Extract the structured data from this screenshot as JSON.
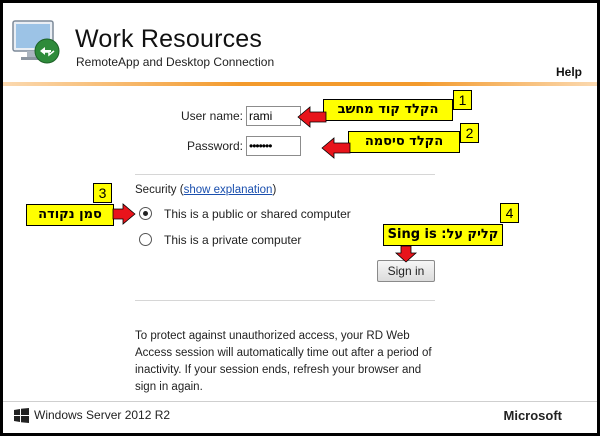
{
  "header": {
    "title": "Work Resources",
    "subtitle": "RemoteApp and Desktop Connection",
    "help": "Help"
  },
  "form": {
    "username_label": "User name:",
    "username_value": "rami",
    "password_label": "Password:",
    "password_value": "•••••••",
    "security_prefix": "Security (",
    "security_link": "show explanation",
    "security_suffix": ")",
    "option_public": "This is a public or shared computer",
    "option_private": "This is a private computer",
    "selected_option": "public",
    "signin_label": "Sign in"
  },
  "notice": "To protect against unauthorized access, your RD Web Access session will automatically time out after a period of inactivity. If your session ends, refresh your browser and sign in again.",
  "footer": {
    "left": "Windows Server 2012 R2",
    "right": "Microsoft"
  },
  "annotations": [
    {
      "num": "1",
      "text": "הקלד קוד מחשב"
    },
    {
      "num": "2",
      "text": "הקלד סיסמה"
    },
    {
      "num": "3",
      "text": "סמן נקודה"
    },
    {
      "num": "4",
      "text": "קליק על: Sing is"
    }
  ],
  "colors": {
    "accent_orange": "#f39a2c",
    "callout_yellow": "#ffff00",
    "arrow_red": "#e8141b",
    "link_blue": "#1a4fae"
  }
}
